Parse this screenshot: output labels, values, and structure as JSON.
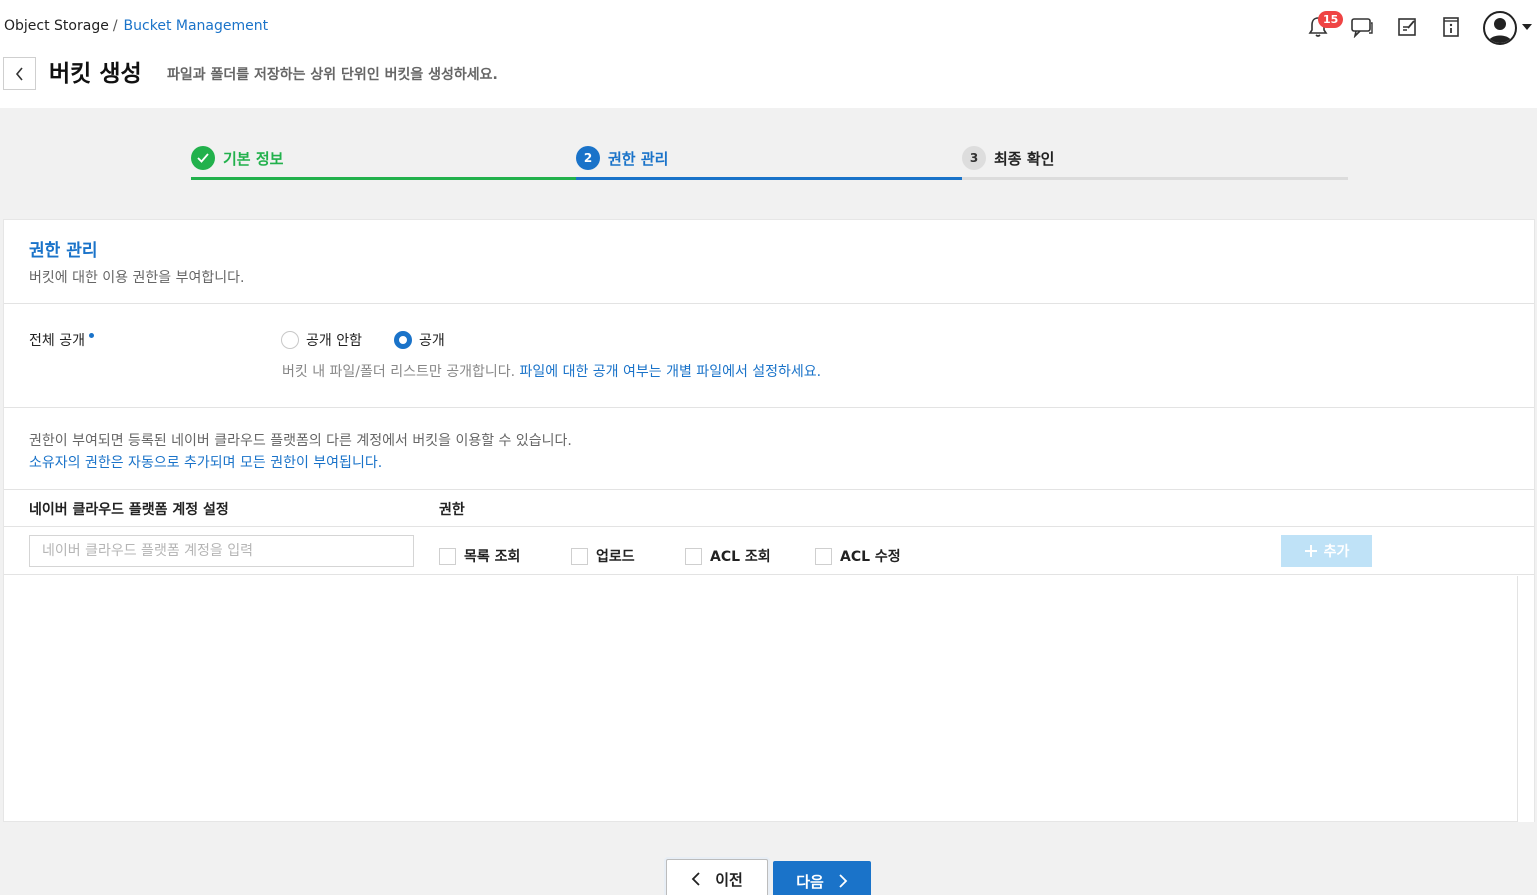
{
  "breadcrumb": {
    "root": "Object Storage",
    "separator": "/",
    "current": "Bucket Management"
  },
  "header": {
    "title": "버킷 생성",
    "description": "파일과 폴더를 저장하는 상위 단위인 버킷을 생성하세요.",
    "notification_count": "15",
    "icons": [
      "bell-icon",
      "chat-icon",
      "memo-icon",
      "info-book-icon",
      "user-avatar-icon"
    ]
  },
  "stepper": {
    "steps": [
      {
        "number": "1",
        "label": "기본 정보",
        "state": "done"
      },
      {
        "number": "2",
        "label": "권한 관리",
        "state": "active"
      },
      {
        "number": "3",
        "label": "최종 확인",
        "state": "todo"
      }
    ]
  },
  "permissions": {
    "title": "권한 관리",
    "description": "버킷에 대한 이용 권한을 부여합니다.",
    "public_label": "전체 공개",
    "radio_private": "공개 안함",
    "radio_public": "공개",
    "selected": "공개",
    "hint_prefix": "버킷 내 파일/폴더 리스트만 공개합니다.",
    "hint_link": "파일에 대한 공개 여부는 개별 파일에서 설정하세요.",
    "notice_line1": "권한이 부여되면 등록된 네이버 클라우드 플랫폼의 다른 계정에서 버킷을 이용할 수 있습니다.",
    "notice_line2": "소유자의 권한은 자동으로 추가되며 모든 권한이 부여됩니다.",
    "col_account": "네이버 클라우드 플랫폼 계정 설정",
    "col_permission": "권한",
    "account_placeholder": "네이버 클라우드 플랫폼 계정을 입력",
    "checkboxes": [
      "목록 조회",
      "업로드",
      "ACL 조회",
      "ACL 수정"
    ],
    "add_button": "추가"
  },
  "footer": {
    "prev_label": "이전",
    "next_label": "다음"
  },
  "colors": {
    "accent": "#1a73c9",
    "success": "#22b14c",
    "badge": "#ef4444",
    "add_disabled": "#bfe2f7"
  }
}
